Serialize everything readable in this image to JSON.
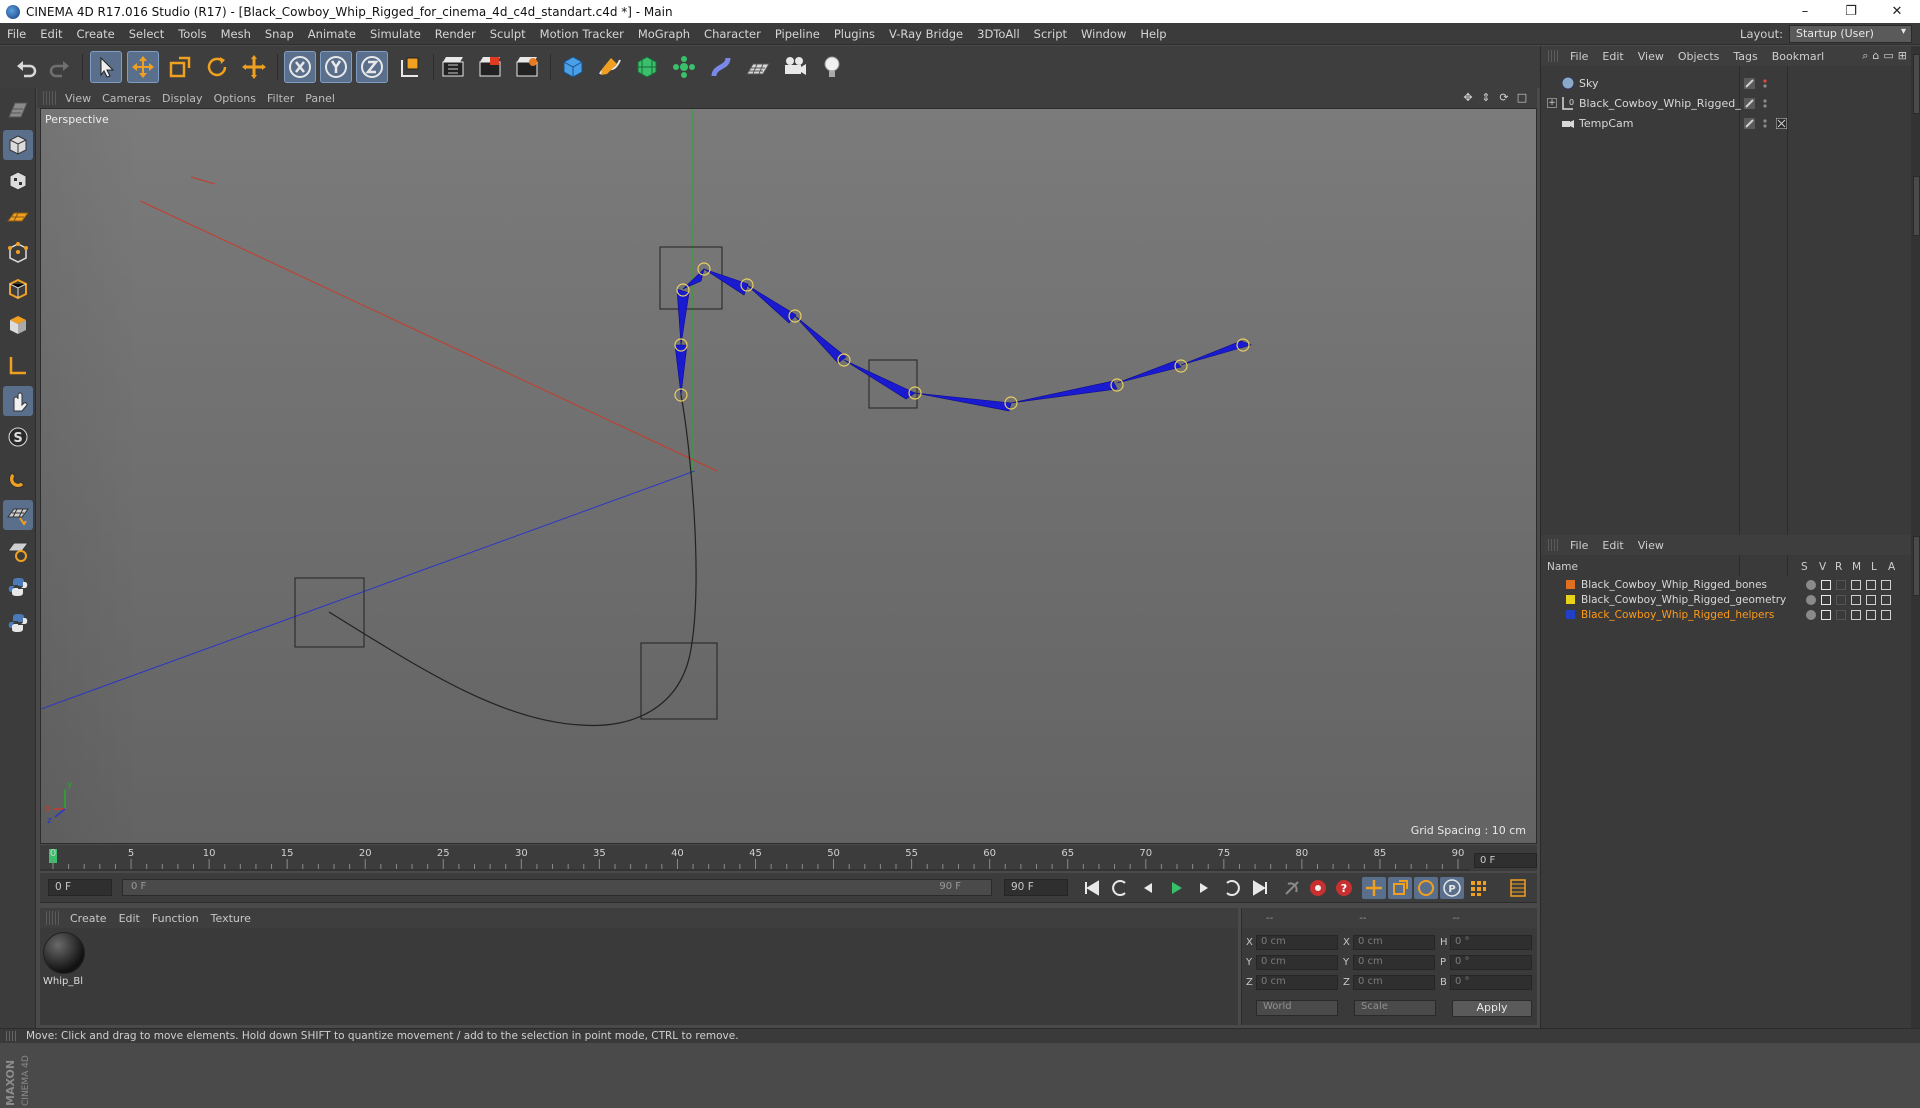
{
  "window": {
    "title": "CINEMA 4D R17.016 Studio (R17) - [Black_Cowboy_Whip_Rigged_for_cinema_4d_c4d_standart.c4d *] - Main",
    "controls": [
      "–",
      "❐",
      "✕"
    ]
  },
  "menu": [
    "File",
    "Edit",
    "Create",
    "Select",
    "Tools",
    "Mesh",
    "Snap",
    "Animate",
    "Simulate",
    "Render",
    "Sculpt",
    "Motion Tracker",
    "MoGraph",
    "Character",
    "Pipeline",
    "Plugins",
    "V-Ray Bridge",
    "3DToAll",
    "Script",
    "Window",
    "Help"
  ],
  "layout": {
    "label": "Layout:",
    "value": "Startup (User)"
  },
  "toolbar": {
    "icons": [
      "undo-icon",
      "redo-icon",
      "select-icon",
      "move-icon",
      "scale-icon",
      "rotate-icon",
      "live-select-icon",
      "x-axis-icon",
      "y-axis-icon",
      "z-axis-icon",
      "coordinate-system-icon",
      "render-view-icon",
      "render-picture-viewer-icon",
      "render-settings-icon",
      "cube-icon",
      "pen-spline-icon",
      "subdivision-icon",
      "array-icon",
      "deformer-icon",
      "floor-icon",
      "camera-icon",
      "light-icon"
    ]
  },
  "viewport": {
    "menus": [
      "View",
      "Cameras",
      "Display",
      "Options",
      "Filter",
      "Panel"
    ],
    "label": "Perspective",
    "grid_spacing": "Grid Spacing : 10 cm",
    "axis_labels": {
      "x": "x",
      "y": "y",
      "z": "z"
    }
  },
  "timeline": {
    "ticks": [
      "0",
      "5",
      "10",
      "15",
      "20",
      "25",
      "30",
      "35",
      "40",
      "45",
      "50",
      "55",
      "60",
      "65",
      "70",
      "75",
      "80",
      "85",
      "90"
    ],
    "current_frame_field": "0 F",
    "start_field": "0 F",
    "slider_start": "0 F",
    "slider_end": "90 F",
    "end_field": "90 F",
    "playhead_frame": 0,
    "max_frame": 90
  },
  "materials": {
    "menus": [
      "Create",
      "Edit",
      "Function",
      "Texture"
    ],
    "items": [
      {
        "name": "Whip_Bl"
      }
    ]
  },
  "coords": {
    "header": [
      "--",
      "--",
      "--"
    ],
    "rows": [
      {
        "l1": "X",
        "v1": "0 cm",
        "l2": "X",
        "v2": "0 cm",
        "l3": "H",
        "v3": "0 °"
      },
      {
        "l1": "Y",
        "v1": "0 cm",
        "l2": "Y",
        "v2": "0 cm",
        "l3": "P",
        "v3": "0 °"
      },
      {
        "l1": "Z",
        "v1": "0 cm",
        "l2": "Z",
        "v2": "0 cm",
        "l3": "B",
        "v3": "0 °"
      }
    ],
    "mode1": "World",
    "mode2": "Scale",
    "apply": "Apply"
  },
  "objects_panel": {
    "menus": [
      "File",
      "Edit",
      "View",
      "Objects",
      "Tags",
      "Bookmarl"
    ],
    "items": [
      {
        "name": "Sky",
        "icon": "sky-icon"
      },
      {
        "name": "Black_Cowboy_Whip_Rigged_",
        "icon": "null-icon"
      },
      {
        "name": "TempCam",
        "icon": "camera-icon"
      }
    ]
  },
  "layers_panel": {
    "menus": [
      "File",
      "Edit",
      "View"
    ],
    "columns": [
      "Name",
      "S",
      "V",
      "R",
      "M",
      "L",
      "A"
    ],
    "items": [
      {
        "name": "Black_Cowboy_Whip_Rigged_bones",
        "color": "#e07020",
        "text_color": "#d8d8d8"
      },
      {
        "name": "Black_Cowboy_Whip_Rigged_geometry",
        "color": "#e8d21a",
        "text_color": "#d8d8d8"
      },
      {
        "name": "Black_Cowboy_Whip_Rigged_helpers",
        "color": "#2040c8",
        "text_color": "#ff9a1a"
      }
    ]
  },
  "status": "Move: Click and drag to move elements. Hold down SHIFT to quantize movement / add to the selection in point mode, CTRL to remove.",
  "brand": {
    "line1": "MAXON",
    "line2": "CINEMA 4D"
  },
  "colors": {
    "accent_active": "#5a6f8c",
    "bone_blue": "#1a1ad0",
    "axis_red": "#c83a2a",
    "axis_green": "#2aa82a",
    "axis_blue": "#2a36c8",
    "layer_highlight": "#ff9a1a"
  }
}
